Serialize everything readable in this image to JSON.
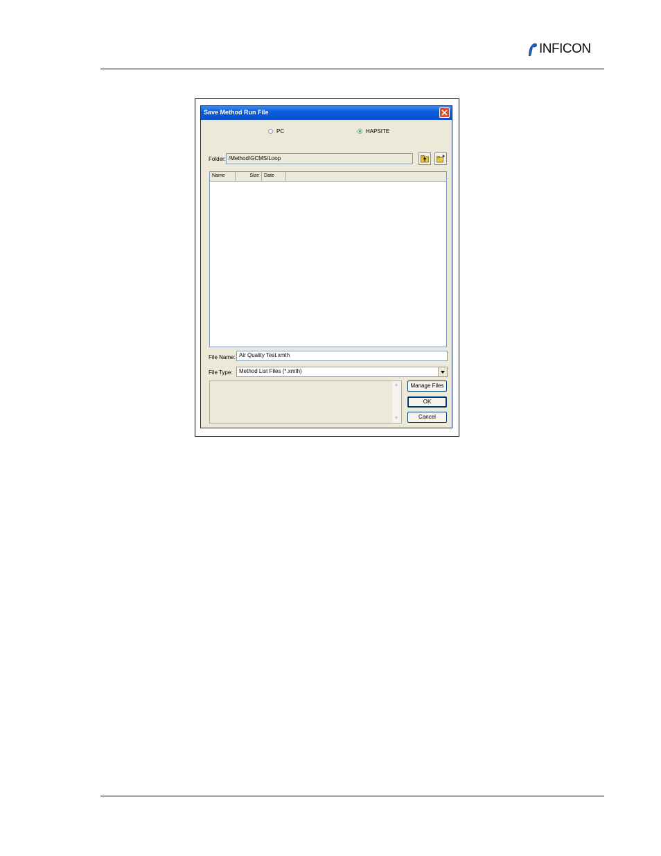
{
  "header": {
    "brand": "INFICON"
  },
  "dialog": {
    "title": "Save Method Run File",
    "radio_pc": "PC",
    "radio_hapsite": "HAPSITE",
    "selected": "HAPSITE",
    "folder_label": "Folder:",
    "folder_value": "/Method/GCMS/Loop",
    "columns": [
      "Name",
      "Size",
      "Date"
    ],
    "file_name_label": "File Name:",
    "file_name_value": "Air Quality Test.xmth",
    "file_type_label": "File Type:",
    "file_type_value": "Method List Files (*.xmth)",
    "buttons": {
      "manage": "Manage Files",
      "ok": "OK",
      "cancel": "Cancel"
    }
  },
  "icons": [
    "logo-icon",
    "close-icon",
    "folder-up-icon",
    "new-folder-icon",
    "scroll-up-icon",
    "scroll-down-icon",
    "dropdown-arrow-icon"
  ]
}
